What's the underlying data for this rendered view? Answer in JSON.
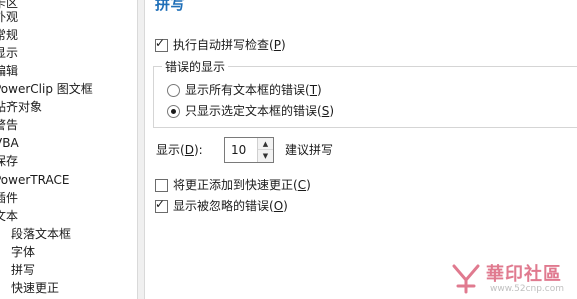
{
  "tree": {
    "items": [
      {
        "label": "卡区",
        "level": 0
      },
      {
        "label": "外观",
        "level": 0
      },
      {
        "label": "常规",
        "level": 0
      },
      {
        "label": "显示",
        "level": 0
      },
      {
        "label": "编辑",
        "level": 0
      },
      {
        "label": "PowerClip 图文框",
        "level": 0
      },
      {
        "label": "贴齐对象",
        "level": 0
      },
      {
        "label": "警告",
        "level": 0
      },
      {
        "label": "VBA",
        "level": 0
      },
      {
        "label": "保存",
        "level": 0
      },
      {
        "label": "PowerTRACE",
        "level": 0
      },
      {
        "label": "插件",
        "level": 0
      },
      {
        "label": "文本",
        "level": 0
      },
      {
        "label": "段落文本框",
        "level": 1
      },
      {
        "label": "字体",
        "level": 1
      },
      {
        "label": "拼写",
        "level": 1
      },
      {
        "label": "快速更正",
        "level": 1
      }
    ],
    "selected": "拼写"
  },
  "panel": {
    "title": "拼写",
    "auto_check": {
      "label": "执行自动拼写检查",
      "key": "P",
      "checked": true
    },
    "error_group": {
      "label": "错误的显示",
      "options": [
        {
          "label": "显示所有文本框的错误",
          "key": "T",
          "selected": false
        },
        {
          "label": "只显示选定文本框的错误",
          "key": "S",
          "selected": true
        }
      ]
    },
    "show_field": {
      "label": "显示",
      "key": "D",
      "value": "10",
      "unit": "建议拼写"
    },
    "add_correction": {
      "label": "将更正添加到快速更正",
      "key": "C",
      "checked": false
    },
    "show_ignored": {
      "label": "显示被忽略的错误",
      "key": "O",
      "checked": true
    }
  },
  "watermark": {
    "text": "華印社區",
    "url": "www.52cnp.com"
  },
  "colors": {
    "title": "#1f6fb8",
    "watermark": "#e07a8f"
  }
}
